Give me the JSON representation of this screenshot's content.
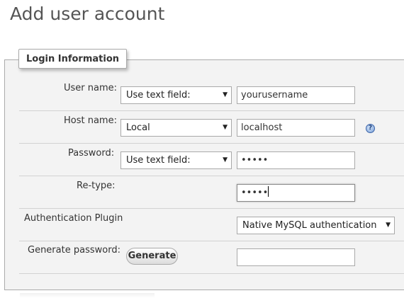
{
  "page": {
    "title": "Add user account"
  },
  "fieldset": {
    "legend": "Login Information"
  },
  "form": {
    "username": {
      "label": "User name:",
      "mode": "Use text field:",
      "value": "yourusername"
    },
    "hostname": {
      "label": "Host name:",
      "mode": "Local",
      "value": "localhost",
      "help_icon": "?"
    },
    "password": {
      "label": "Password:",
      "mode": "Use text field:",
      "value": "•••••"
    },
    "retype": {
      "label": "Re-type:",
      "value": "•••••"
    },
    "auth_plugin": {
      "label": "Authentication Plugin",
      "selected": "Native MySQL authentication"
    },
    "generate": {
      "label": "Generate password:",
      "button": "Generate",
      "value": ""
    }
  },
  "icons": {
    "dropdown_arrow": "▼",
    "help": "help-icon"
  },
  "colors": {
    "title": "#555555",
    "panel_background": "#f3f3f3",
    "border": "#aaaaaa",
    "help_icon": "#3a63a8"
  }
}
